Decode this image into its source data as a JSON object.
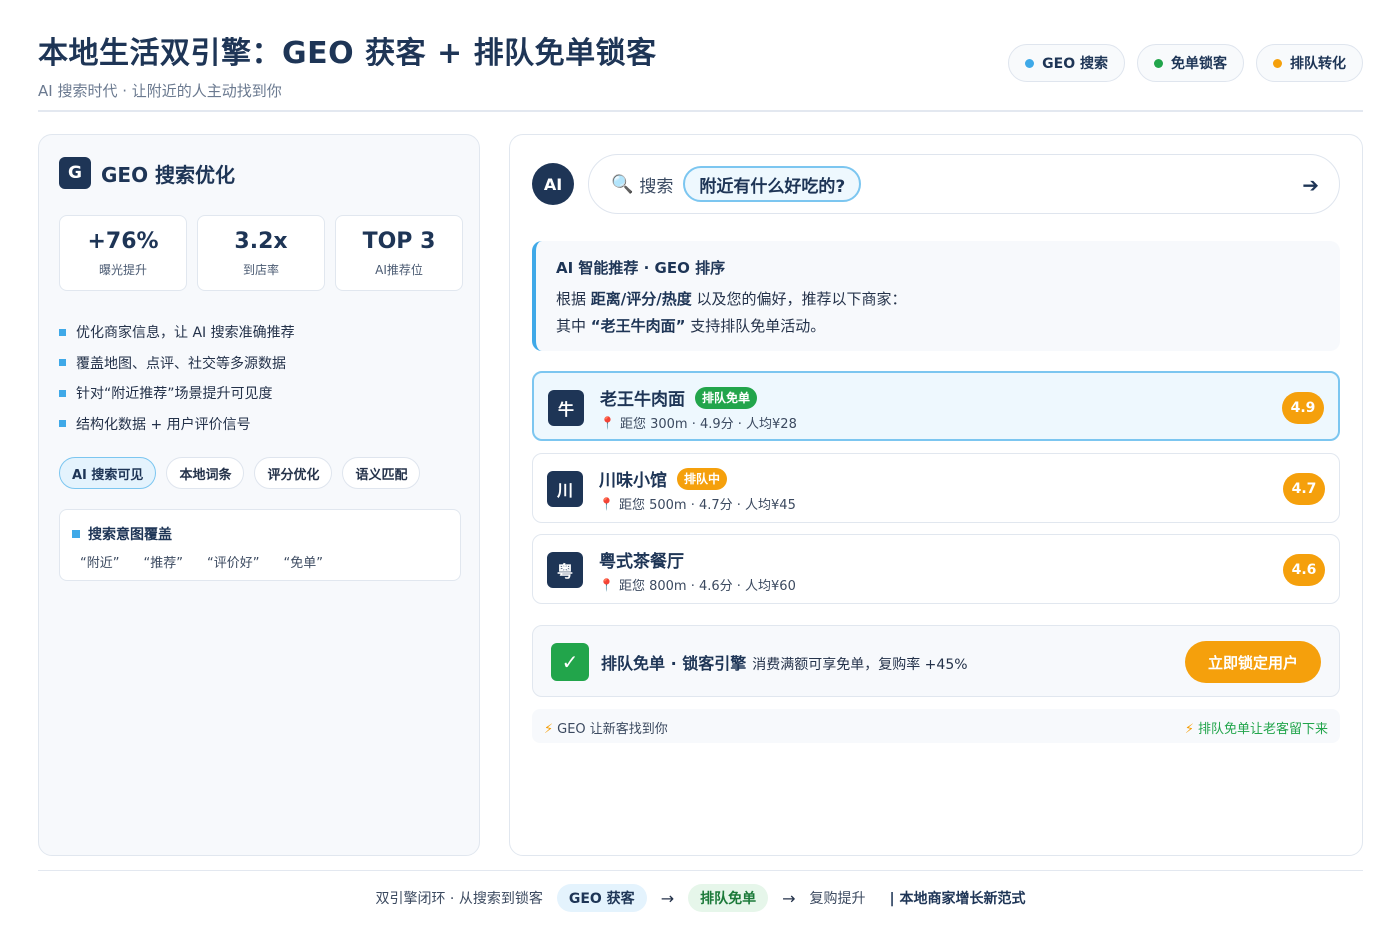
{
  "header": {
    "title": "本地生活双引擎：GEO 获客 + 排队免单锁客",
    "subtitle": "AI 搜索时代 · 让附近的人主动找到你",
    "legend": [
      {
        "label": "GEO 搜索",
        "color": "#3fa9e8"
      },
      {
        "label": "免单锁客",
        "color": "#22a54b"
      },
      {
        "label": "排队转化",
        "color": "#f5a00c"
      }
    ]
  },
  "left": {
    "badge": "G",
    "title": "GEO 搜索优化",
    "stats": [
      {
        "value": "+76%",
        "label": "曝光提升"
      },
      {
        "value": "3.2x",
        "label": "到店率"
      },
      {
        "value": "TOP 3",
        "label": "AI推荐位"
      }
    ],
    "bullets": [
      "优化商家信息，让 AI 搜索准确推荐",
      "覆盖地图、点评、社交等多源数据",
      "针对“附近推荐”场景提升可见度",
      "结构化数据 + 用户评价信号"
    ],
    "tags": [
      "AI 搜索可见",
      "本地词条",
      "评分优化",
      "语义匹配"
    ],
    "intent": {
      "title": "搜索意图覆盖",
      "words": [
        "“附近”",
        "“推荐”",
        "“评价好”",
        "“免单”"
      ]
    }
  },
  "right": {
    "avatar": "AI",
    "search": {
      "label": "搜索",
      "query": "附近有什么好吃的?",
      "arrow": "➔"
    },
    "recommend": {
      "title": "AI 智能推荐 · GEO 排序",
      "line1_pre": "根据 ",
      "line1_bold": "距离/评分/热度",
      "line1_post": " 以及您的偏好，推荐以下商家：",
      "line2_pre": "其中 ",
      "line2_bold": "“老王牛肉面”",
      "line2_post": " 支持排队免单活动。"
    },
    "shops": [
      {
        "icon": "牛",
        "name": "老王牛肉面",
        "badge": "排队免单",
        "meta": "距您 300m · 4.9分 · 人均¥28",
        "rating": "4.9"
      },
      {
        "icon": "川",
        "name": "川味小馆",
        "badge": "排队中",
        "meta": "距您 500m · 4.7分 · 人均¥45",
        "rating": "4.7"
      },
      {
        "icon": "粤",
        "name": "粤式茶餐厅",
        "badge": "",
        "meta": "距您 800m · 4.6分 · 人均¥60",
        "rating": "4.6"
      }
    ],
    "cta": {
      "strong": "排队免单 · 锁客引擎",
      "desc": "消费满额可享免单，复购率 +45%",
      "button": "立即锁定用户"
    },
    "footer": {
      "left": "GEO 让新客找到你",
      "right": "排队免单让老客留下来"
    }
  },
  "bottom": {
    "prefix": "双引擎闭环 · 从搜索到锁客",
    "step1": "GEO 获客",
    "step2": "排队免单",
    "step3": "复购提升",
    "end": "| 本地商家增长新范式"
  }
}
